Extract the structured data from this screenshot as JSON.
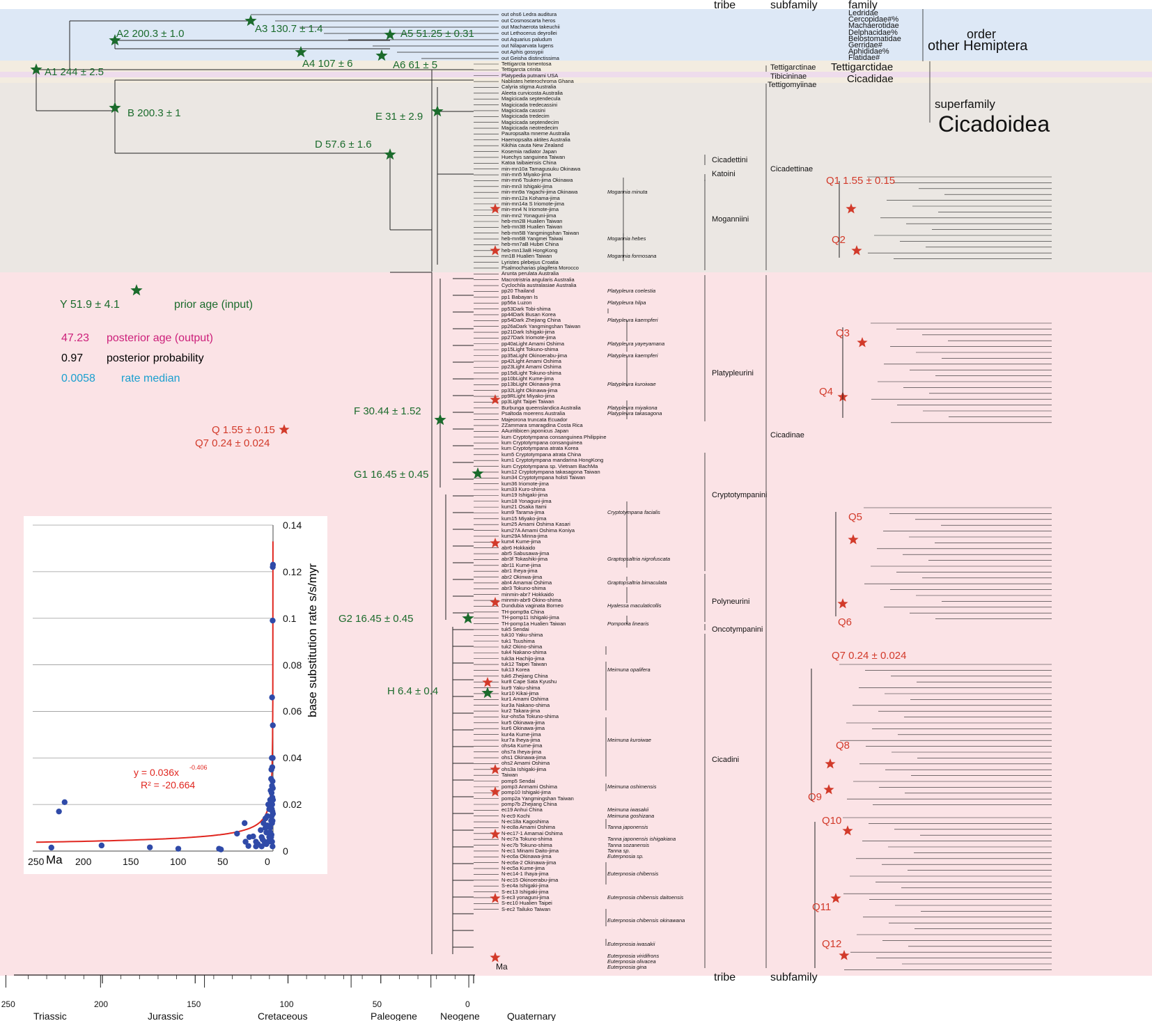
{
  "headers": {
    "tribe_top": "tribe",
    "subfamily_top": "subfamily",
    "family_top": "family",
    "tribe_bottom": "tribe",
    "subfamily_bottom": "subfamily",
    "order_label": "order",
    "order_name": "other Hemiptera",
    "superfamily_label": "superfamily",
    "superfamily_name": "Cicadoidea"
  },
  "families": [
    "Ledridae",
    "Cercopidae#%",
    "Machaerotidae",
    "Delphacidae%",
    "Belostomatidae",
    "Gerridae#",
    "Aphididae%",
    "Flatidae#"
  ],
  "family_labels": {
    "tettigarctidae": "Tettigarctidae",
    "cicadidae": "Cicadidae"
  },
  "subfamilies": {
    "tettigarctinae": "Tettigarctinae",
    "tibicininae": "Tibicininae",
    "tettigomyiinae": "Tettigomyiinae",
    "cicadettinae": "Cicadettinae",
    "cicadinae": "Cicadinae"
  },
  "tribes": {
    "cicadettini": "Cicadettini",
    "katoini": "Katoini",
    "moganniini": "Moganniini",
    "platypleurini": "Platypleurini",
    "cryptotympanini": "Cryptotympanini",
    "polyneurini": "Polyneurini",
    "oncotympanini": "Oncotympanini",
    "cicadini": "Cicadini"
  },
  "calibrations": {
    "A1": "A1  244 ± 2.5",
    "A2": "A2  200.3 ± 1.0",
    "A3": "A3  130.7 ± 1.4",
    "A4": "A4  107 ± 6",
    "A5": "A5  51.25 ± 0.31",
    "A6": "A6  61 ± 5",
    "B": "B  200.3 ± 1",
    "D": "D  57.6 ± 1.6",
    "E": "E  31 ± 2.9",
    "F": "F  30.44 ± 1.52",
    "G1": "G1  16.45 ± 0.45",
    "G2": "G2  16.45 ± 0.45",
    "H": "H  6.4 ± 0.4",
    "Q": "Q  1.55 ± 0.15",
    "Q7": "Q7  0.24 ± 0.024",
    "Q1": "Q1  1.55 ± 0.15",
    "Q2": "Q2",
    "Q3": "Q3",
    "Q4": "Q4",
    "Q5": "Q5",
    "Q6": "Q6",
    "Q7r": "Q7  0.24 ± 0.024",
    "Q8": "Q8",
    "Q9": "Q9",
    "Q10": "Q10",
    "Q11": "Q11",
    "Q12": "Q12"
  },
  "legend": {
    "example_prior": "Y  51.9 ± 4.1",
    "prior_label": "prior age (input)",
    "posterior_value": "47.23",
    "posterior_label": "posterior age (output)",
    "prob_value": "0.97",
    "prob_label": "posterior probability",
    "rate_value": "0.0058",
    "rate_label": "rate median"
  },
  "colors": {
    "prior_green": "#1b6b2c",
    "posterior_magenta": "#cc1f7a",
    "probability_black": "#111111",
    "rate_cyan": "#1a9fcf",
    "star_red": "#d23a2a",
    "band_blue": "#dde8f6",
    "band_beige": "#f3ece0",
    "band_grey": "#ebe7e3",
    "band_pink": "#fbe3e6",
    "band_lavender": "#eedcec",
    "fit_red": "#e0261f",
    "point_blue": "#2f4aa8"
  },
  "timescale": {
    "unit": "Ma",
    "ticks": [
      "250",
      "200",
      "150",
      "100",
      "50",
      "0"
    ],
    "periods": [
      "Triassic",
      "Jurassic",
      "Cretaceous",
      "Paleogene",
      "Neogene",
      "Quaternary"
    ]
  },
  "outgroups": [
    "out ohs6 Ledra auditura",
    "out Cosmoscarta heros",
    "out Machaerota takeuchii",
    "out Lethocerus deyrollei",
    "out Aquarius paludum",
    "out Nilaparvata lugens",
    "out Aphis gossypii",
    "out Geisha distinctissima"
  ],
  "tips": [
    "Tettigarcta tomentosa",
    "Tettigarcta crinita",
    "Platypedia putnami USA",
    "Nablistes heterochroma Ghana",
    "Calyria stigma Australia",
    "Aleeta curvicosta Australia",
    "Magicicada septendecula",
    "Magicicada tredecassini",
    "Magicicada cassini",
    "Magicicada tredecim",
    "Magicicada septendecim",
    "Magicicada neotredecim",
    "Pauropsalta mneme Australia",
    "Haemopsalta aktites Australia",
    "Kikihia cauta New Zealand",
    "Kosemia radiator Japan",
    "Huechys sanguinea Taiwan",
    "Katoa taibaiensis China",
    "min-mn10a Tamagusuku Okinawa",
    "min-mn5 Miyako-jima",
    "min-mn6 Tsuken-jima Okinawa",
    "min-mn3 Ishigaki-jima",
    "min-mn9a Yagachi-jima Okinawa",
    "min-mn12a Kohama-jima",
    "min-mn14a S Iriomote-jima",
    "min-mn4 N Iriomote-jima",
    "min-mn2 Yonaguni-jima",
    "heb-mn2B Hualien Taiwan",
    "heb-mn3B Hualien Taiwan",
    "heb-mn5B Yangmingshan Taiwan",
    "heb-mn6B Yangmei Taiwai",
    "heb-mn7aB Hubei China",
    "heb-mn13aB HongKong",
    "mn1B Hualien Taiwan",
    "Lyristes plebejus Croatia",
    "Psalmocharias plagifera Morocco",
    "Arunta perulata Australia",
    "Macrotristria angularis Australia",
    "Cyclochila australasiae Australia",
    "pp20 Thailand",
    "pp1 Babayan Is",
    "pp56a Luzon",
    "pp53Dark Tobi-shima",
    "pp44Dark Busan Korea",
    "pp54Dark Zhejiang China",
    "pp26aDark Yangmingshan Taiwan",
    "pp21Dark Ishigaki-jima",
    "pp27Dark Iriomote-jima",
    "pp40aLight Amami Oshima",
    "pp15Light Tokuno-shima",
    "pp35aLight Okinoerabu-jima",
    "pp42Light Amami Oshima",
    "pp23Light Amami Oshima",
    "pp15dLight Tokuno-shima",
    "pp10bLight Kume-jima",
    "pp13bLight Okinawa-jima",
    "pp32Light Okinawa-jima",
    "pp9RLight Miyako-jima",
    "pp3Light Taipei Taiwan",
    "Burbunga queenslandica Australia",
    "Psaltoda moerens Australia",
    "Majeorona truncata Ecuador",
    "ZZammara smaragdina Costa Rica",
    "AAuritibicen japonicus Japan",
    "kum Cryptotympana consanguinea Philippine",
    "kum Cryptotympana consanguinea",
    "kum Cryptotympana atrata Korea",
    "kum5 Cryptotympana atrata China",
    "kum1 Cryptotympana mandarina HongKong",
    "kum Cryptotympana sp. Vietnam BachMa",
    "kum12 Cryptotympana takasagona Taiwan",
    "kum34 Cryptotympana holsti Taiwan",
    "kum36 Iriomote-jima",
    "kum33 Kuro-shima",
    "kum19 Ishigaki-jima",
    "kum18 Yonaguni-jima",
    "kum21 Osaka Itami",
    "kum9 Tarama-jima",
    "kum15 Miyako-jima",
    "kum25 Amami Oshima Kasari",
    "kum27A Amami Oshima Koniya",
    "kum29A Minna-jima",
    "kum4 Kume-jima",
    "abr6 Hokkaido",
    "abr5 Sabusawa-jima",
    "abr3f Tokashiki-jima",
    "abr11 Kume-jima",
    "abr1 Iheya-jima",
    "abr2 Okinwa-jima",
    "abr4 Amamai Oshima",
    "abr3 Tokuno-shima",
    "minmin-abr7 Hokkaido",
    "minmin-abr9 Okino-shima",
    "Dundubia vaginata Borneo",
    "TH-pomp9a China",
    "TH-pomp11 Ishigaki-jima",
    "TH-pomp1a Hualien Taiwan",
    "tuk5 Sendai",
    "tuk10 Yaku-shima",
    "tuk1 Tsushima",
    "tuk2 Okino-shima",
    "tuk4 Nakano-shima",
    "tuk3a Hachijo-jima",
    "tuk12 Taipei Taiwan",
    "tuk13 Korea",
    "tuk6 Zhejiang China",
    "kur8 Cape Sata Kyushu",
    "kur9 Yaku-shima",
    "kur10 Kikai-jima",
    "kur1 Amami Oshima",
    "kur3a Nakano-shima",
    "kur2 Takara-jima",
    "kur-ohs5a Tokuno-shima",
    "kur5 Okinawa-jima",
    "kur6 Okinawa-jima",
    "kur4a Kume-jima",
    "kur7a Iheya-jima",
    "ohs4a Kume-jima",
    "ohs7a Iheya-jima",
    "ohs1 Okinawa-jima",
    "ohs2 Amami Oshima",
    "ohs3a Ishigaki-jima",
    "Taiwan",
    "pomp5 Sendai",
    "pomp3 Anmami Oshima",
    "pomp10 Ishigaki-jima",
    "pomp2a Yangmingshan Taiwan",
    "pomp7b Zhejiang China",
    "ec19 Anhui China",
    "N-ec9 Kochi",
    "N-ec18a Kagoshima",
    "N-ec8a Amami Oshima",
    "N-ec17-1 Amamai Oshima",
    "N-ec7a Tokuno-shima",
    "N-ec7b Tokuno-shima",
    "N-ec1 Minami Daito-jima",
    "N-ec6a Okinawa-jima",
    "N-ec6a-2 Okinawa-jima",
    "N-ec5a Kume-jima",
    "N-ec14-1 Ihaya-jima",
    "N-ec15 Okinoerabu-jima",
    "S-ec4a Ishigaki-jima",
    "S-ec13 Ishigaki-jima",
    "S-ec3 yonaguni-jima",
    "S-ec10 Hualien Taipei",
    "S-ec2 Tailuko Taiwan"
  ],
  "species_labels": [
    {
      "text": "Mogannia minuta",
      "row": 22
    },
    {
      "text": "Mogannia hebes",
      "row": 30
    },
    {
      "text": "Mogannia formosana",
      "row": 33
    },
    {
      "text": "Platypleura coelestia",
      "row": 39
    },
    {
      "text": "Platypleura hilpa",
      "row": 41
    },
    {
      "text": "Platypleura kaempferi",
      "row": 44
    },
    {
      "text": "Platypleura yayeyamana",
      "row": 48
    },
    {
      "text": "Platypleura kaempferi",
      "row": 50
    },
    {
      "text": "Platypleura kuroiwae",
      "row": 55
    },
    {
      "text": "Platypleura miyakona",
      "row": 59
    },
    {
      "text": "Platypleura takasagona",
      "row": 60
    },
    {
      "text": "Cryptotympana facialis",
      "row": 77
    },
    {
      "text": "Graptopsaltria nigrofuscata",
      "row": 85
    },
    {
      "text": "Graptopsaltria bimaculata",
      "row": 89
    },
    {
      "text": "Hyalessa maculaticollis",
      "row": 93
    },
    {
      "text": "Pomponia linearis",
      "row": 96
    },
    {
      "text": "Meimuna opalifera",
      "row": 104
    },
    {
      "text": "Meimuna kuroiwae",
      "row": 116
    },
    {
      "text": "Meimuna oshimensis",
      "row": 124
    },
    {
      "text": "Meimuna iwasakii",
      "row": 128
    },
    {
      "text": "Meimuna goshizana",
      "row": 129
    },
    {
      "text": "Tanna japonensis",
      "row": 131
    },
    {
      "text": "Tanna japonensis ishigakiana",
      "row": 133
    },
    {
      "text": "Tanna sozanensis",
      "row": 134
    },
    {
      "text": "Tanna  sp.",
      "row": 135
    },
    {
      "text": "Euterpnosia sp.",
      "row": 136
    },
    {
      "text": "Euterpnosia chibensis",
      "row": 139
    },
    {
      "text": "Euterpnosia chibensis daitoensis",
      "row": 143
    },
    {
      "text": "Euterpnosia chibensis okinawana",
      "row": 147
    },
    {
      "text": "Euterpnosia iwasakii",
      "row": 151
    },
    {
      "text": "Euterpnosia viridifrons",
      "row": 153
    },
    {
      "text": "Euterpnosia olivacea",
      "row": 154
    },
    {
      "text": "Euterpnosia gina",
      "row": 155
    }
  ],
  "inset_chart": {
    "ylabel": "base substitution rate s/s/myr",
    "xunit": "Ma",
    "equation": "y = 0.036x",
    "equation_exp": "-0.406",
    "r2": "R² = -20.664",
    "xticks": [
      "250",
      "200",
      "150",
      "100",
      "50",
      "0"
    ],
    "yticks": [
      "0",
      "0.02",
      "0.04",
      "0.06",
      "0.08",
      "0.1",
      "0.12",
      "0.14"
    ]
  },
  "chart_data": {
    "type": "scatter",
    "title": "",
    "xlabel": "Ma",
    "ylabel": "base substitution rate s/s/myr",
    "xlim": [
      250,
      0
    ],
    "ylim": [
      0,
      0.14
    ],
    "grid": true,
    "fit": {
      "form": "power",
      "a": 0.036,
      "b": -0.406,
      "label": "y = 0.036x-0.406",
      "r2": "R² = -20.664"
    },
    "series": [
      {
        "x": [
          234,
          220,
          226,
          181,
          130,
          100,
          57,
          55,
          38,
          30,
          29,
          26,
          21,
          18,
          16,
          13,
          12,
          11,
          10,
          9,
          8,
          7,
          7,
          6,
          5,
          5,
          4,
          4,
          3,
          3,
          2.5,
          2,
          2,
          1.7,
          1.6,
          1.5,
          1.4,
          1.3,
          1.2,
          1.1,
          1,
          1,
          0.9,
          0.8,
          0.7,
          0.6,
          0.5,
          0.5,
          0.4,
          0.3,
          0.3,
          0.2,
          0.2,
          0.1,
          0.1,
          0.05,
          3,
          2,
          1,
          0.5,
          12,
          18,
          25,
          8,
          6
        ],
        "y": [
          0.0015,
          0.021,
          0.017,
          0.0024,
          0.0016,
          0.001,
          0.001,
          0.0007,
          0.0075,
          0.012,
          0.004,
          0.0022,
          0.0063,
          0.002,
          0.003,
          0.009,
          0.006,
          0.005,
          0.012,
          0.004,
          0.01,
          0.008,
          0.003,
          0.015,
          0.004,
          0.02,
          0.018,
          0.006,
          0.01,
          0.022,
          0.026,
          0.013,
          0.031,
          0.035,
          0.007,
          0.025,
          0.015,
          0.04,
          0.018,
          0.028,
          0.066,
          0.012,
          0.02,
          0.036,
          0.023,
          0.017,
          0.013,
          0.03,
          0.099,
          0.122,
          0.04,
          0.027,
          0.054,
          0.016,
          0.022,
          0.123,
          0.008,
          0.006,
          0.004,
          0.002,
          0.002,
          0.004,
          0.006,
          0.014,
          0.011
        ]
      }
    ]
  }
}
